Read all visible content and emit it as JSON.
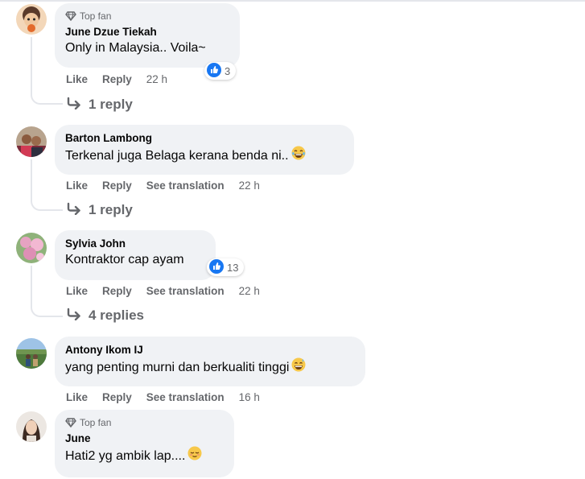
{
  "comments": [
    {
      "badge": "Top fan",
      "author": "June Dzue Tiekah",
      "text": "Only in Malaysia.. Voila~",
      "emoji": null,
      "actions": {
        "like": "Like",
        "reply": "Reply",
        "translate": null,
        "time": "22 h"
      },
      "reactions": {
        "icon": "like-icon",
        "count": "3"
      },
      "replies": "1 reply"
    },
    {
      "badge": null,
      "author": "Barton Lambong",
      "text": "Terkenal juga Belaga kerana benda ni..",
      "emoji": "laughing-tears-emoji",
      "actions": {
        "like": "Like",
        "reply": "Reply",
        "translate": "See translation",
        "time": "22 h"
      },
      "reactions": null,
      "replies": "1 reply"
    },
    {
      "badge": null,
      "author": "Sylvia John",
      "text": "Kontraktor cap ayam",
      "emoji": null,
      "actions": {
        "like": "Like",
        "reply": "Reply",
        "translate": "See translation",
        "time": "22 h"
      },
      "reactions": {
        "icon": "like-icon",
        "count": "13"
      },
      "replies": "4 replies"
    },
    {
      "badge": null,
      "author": "Antony Ikom IJ",
      "text": "yang penting murni dan berkualiti tinggi",
      "emoji": "grinning-sweat-emoji",
      "actions": {
        "like": "Like",
        "reply": "Reply",
        "translate": "See translation",
        "time": "16 h"
      },
      "reactions": null,
      "replies": null
    },
    {
      "badge": "Top fan",
      "author": "June",
      "text": "Hati2 yg ambik lap....",
      "emoji": "relieved-face-emoji",
      "actions": null,
      "reactions": null,
      "replies": null
    }
  ],
  "colors": {
    "like_blue": "#1877f2",
    "bubble": "#f0f2f5",
    "muted": "#65676b"
  }
}
